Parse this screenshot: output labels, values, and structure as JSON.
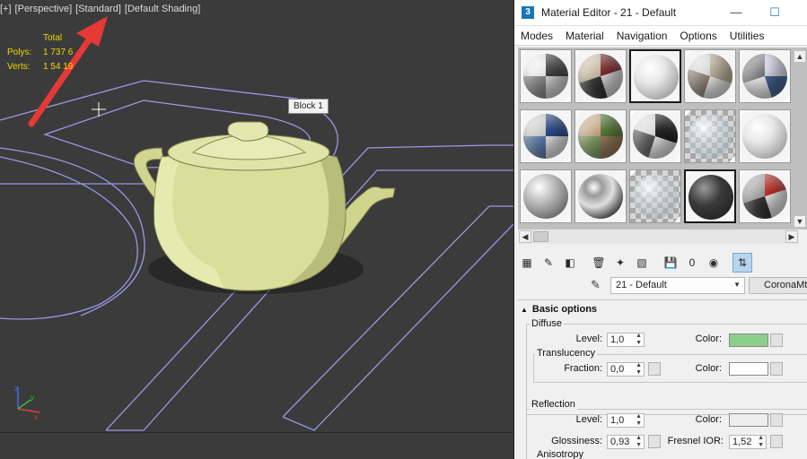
{
  "viewport": {
    "labels": [
      "[+]",
      "[Perspective]",
      "[Standard]",
      "[Default Shading]"
    ],
    "stats": {
      "header": "Total",
      "polys_label": "Polys:",
      "polys_value": "1 737 6",
      "verts_label": "Verts:",
      "verts_value": "1 54  19"
    },
    "tooltip": "Block 1",
    "axis": {
      "x": "x",
      "y": "y",
      "z": "z"
    },
    "colors": {
      "background": "#3b3b3b",
      "teapot": "#d9df9a",
      "lines": "#9b97e6",
      "arrow": "#e53935"
    }
  },
  "material_editor": {
    "title": "Material Editor - 21 - Default",
    "app_icon": "3",
    "menus": [
      "Modes",
      "Material",
      "Navigation",
      "Options",
      "Utilities"
    ],
    "window_buttons": {
      "minimize": "—",
      "maximize": "☐"
    },
    "slots": [
      {
        "name": "slot-1",
        "style": "patch-gray"
      },
      {
        "name": "slot-2",
        "style": "patch-red"
      },
      {
        "name": "slot-3",
        "style": "white"
      },
      {
        "name": "slot-4",
        "style": "patch-tan"
      },
      {
        "name": "slot-5",
        "style": "patch-blue"
      },
      {
        "name": "slot-6",
        "style": "patch-blue2"
      },
      {
        "name": "slot-7",
        "style": "patch-green"
      },
      {
        "name": "slot-8",
        "style": "patch-dark"
      },
      {
        "name": "slot-9",
        "style": "glass"
      },
      {
        "name": "slot-10",
        "style": "white"
      },
      {
        "name": "slot-11",
        "style": "silver"
      },
      {
        "name": "slot-12",
        "style": "chrome"
      },
      {
        "name": "slot-13",
        "style": "glass"
      },
      {
        "name": "slot-14",
        "style": "dark"
      },
      {
        "name": "slot-15",
        "style": "patch-multi"
      }
    ],
    "scroll": {
      "up": "▲",
      "down": "▼",
      "left": "◀",
      "right": "▶"
    },
    "toolbar_icons": [
      "get-material-icon",
      "put-to-scene-icon",
      "assign-to-selection-icon",
      "reset-map-icon",
      "make-unique-icon",
      "put-to-library-icon",
      "material-id-icon",
      "show-shaded-icon",
      "show-end-result-icon",
      "go-to-parent-icon"
    ],
    "toolbar_glyphs": [
      "▦",
      "✎",
      "◧",
      "🗑",
      "✦",
      "▧",
      "💾",
      "0",
      "◉",
      "⇅"
    ],
    "material_name": "21 - Default",
    "material_type": "CoronaMtl",
    "rollout": {
      "title": "Basic options",
      "diffuse": {
        "group": "Diffuse",
        "level_label": "Level:",
        "level_value": "1,0",
        "color_label": "Color:",
        "color": "#8ccf8a"
      },
      "translucency": {
        "group": "Translucency",
        "fraction_label": "Fraction:",
        "fraction_value": "0,0",
        "color_label": "Color:",
        "color": "#ffffff"
      },
      "reflection": {
        "group": "Reflection",
        "level_label": "Level:",
        "level_value": "1,0",
        "color_label": "Color:",
        "color": "#eeeeee",
        "glossiness_label": "Glossiness:",
        "glossiness_value": "0,93",
        "ior_label": "Fresnel IOR:",
        "ior_value": "1,52"
      },
      "anisotropy": {
        "group": "Anisotropy"
      }
    }
  }
}
